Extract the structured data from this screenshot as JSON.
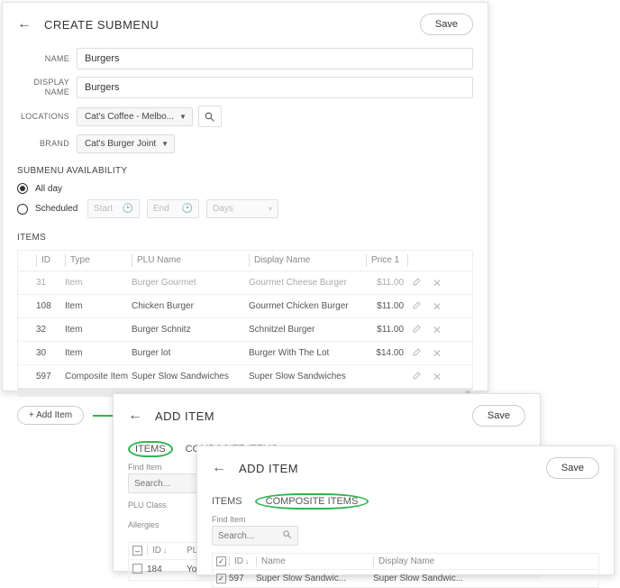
{
  "main": {
    "title": "CREATE SUBMENU",
    "save": "Save",
    "labels": {
      "name": "NAME",
      "display_name": "DISPLAY\nNAME",
      "locations": "LOCATIONS",
      "brand": "BRAND"
    },
    "values": {
      "name": "Burgers",
      "display_name": "Burgers",
      "location": "Cat's Coffee - Melbo...",
      "brand": "Cat's Burger Joint"
    },
    "availability": {
      "section": "SUBMENU AVAILABILITY",
      "all_day": "All day",
      "scheduled": "Scheduled",
      "start": "Start",
      "end": "End",
      "days": "Days"
    },
    "items_section": "ITEMS",
    "table": {
      "headers": {
        "id": "ID",
        "type": "Type",
        "plu": "PLU Name",
        "display": "Display Name",
        "price": "Price 1"
      },
      "rows": [
        {
          "id": "31",
          "type": "Item",
          "plu": "Burger Gourmet",
          "display": "Gourmet Cheese Burger",
          "price": "$11.00",
          "cut": true
        },
        {
          "id": "108",
          "type": "Item",
          "plu": "Chicken Burger",
          "display": "Gourmet Chicken Burger",
          "price": "$11.00",
          "cut": false
        },
        {
          "id": "32",
          "type": "Item",
          "plu": "Burger Schnitz",
          "display": "Schnitzel Burger",
          "price": "$11.00",
          "cut": false
        },
        {
          "id": "30",
          "type": "Item",
          "plu": "Burger lot",
          "display": "Burger With The Lot",
          "price": "$14.00",
          "cut": false
        },
        {
          "id": "597",
          "type": "Composite Item",
          "plu": "Super Slow Sandwiches",
          "display": "Super Slow Sandwiches",
          "price": "",
          "cut": false
        }
      ]
    },
    "add_item": "+ Add Item"
  },
  "items_panel": {
    "title": "ADD ITEM",
    "save": "Save",
    "tab_items": "ITEMS",
    "tab_composite": "COMPOSITE ITEMS",
    "find_label": "Find Item",
    "search_placeholder": "Search...",
    "plu_class": "PLU Class",
    "allergies": "Allergies",
    "table": {
      "id": "ID",
      "plu": "PLU",
      "row": {
        "id": "184",
        "plu": "Yog"
      }
    }
  },
  "comp_panel": {
    "title": "ADD ITEM",
    "save": "Save",
    "tab_items": "ITEMS",
    "tab_composite": "COMPOSITE ITEMS",
    "find_label": "Find Item",
    "search_placeholder": "Search...",
    "table": {
      "id": "ID",
      "name": "Name",
      "display": "Display Name",
      "row": {
        "id": "597",
        "name": "Super Slow Sandwic...",
        "display": "Super Slow Sandwic..."
      }
    }
  }
}
